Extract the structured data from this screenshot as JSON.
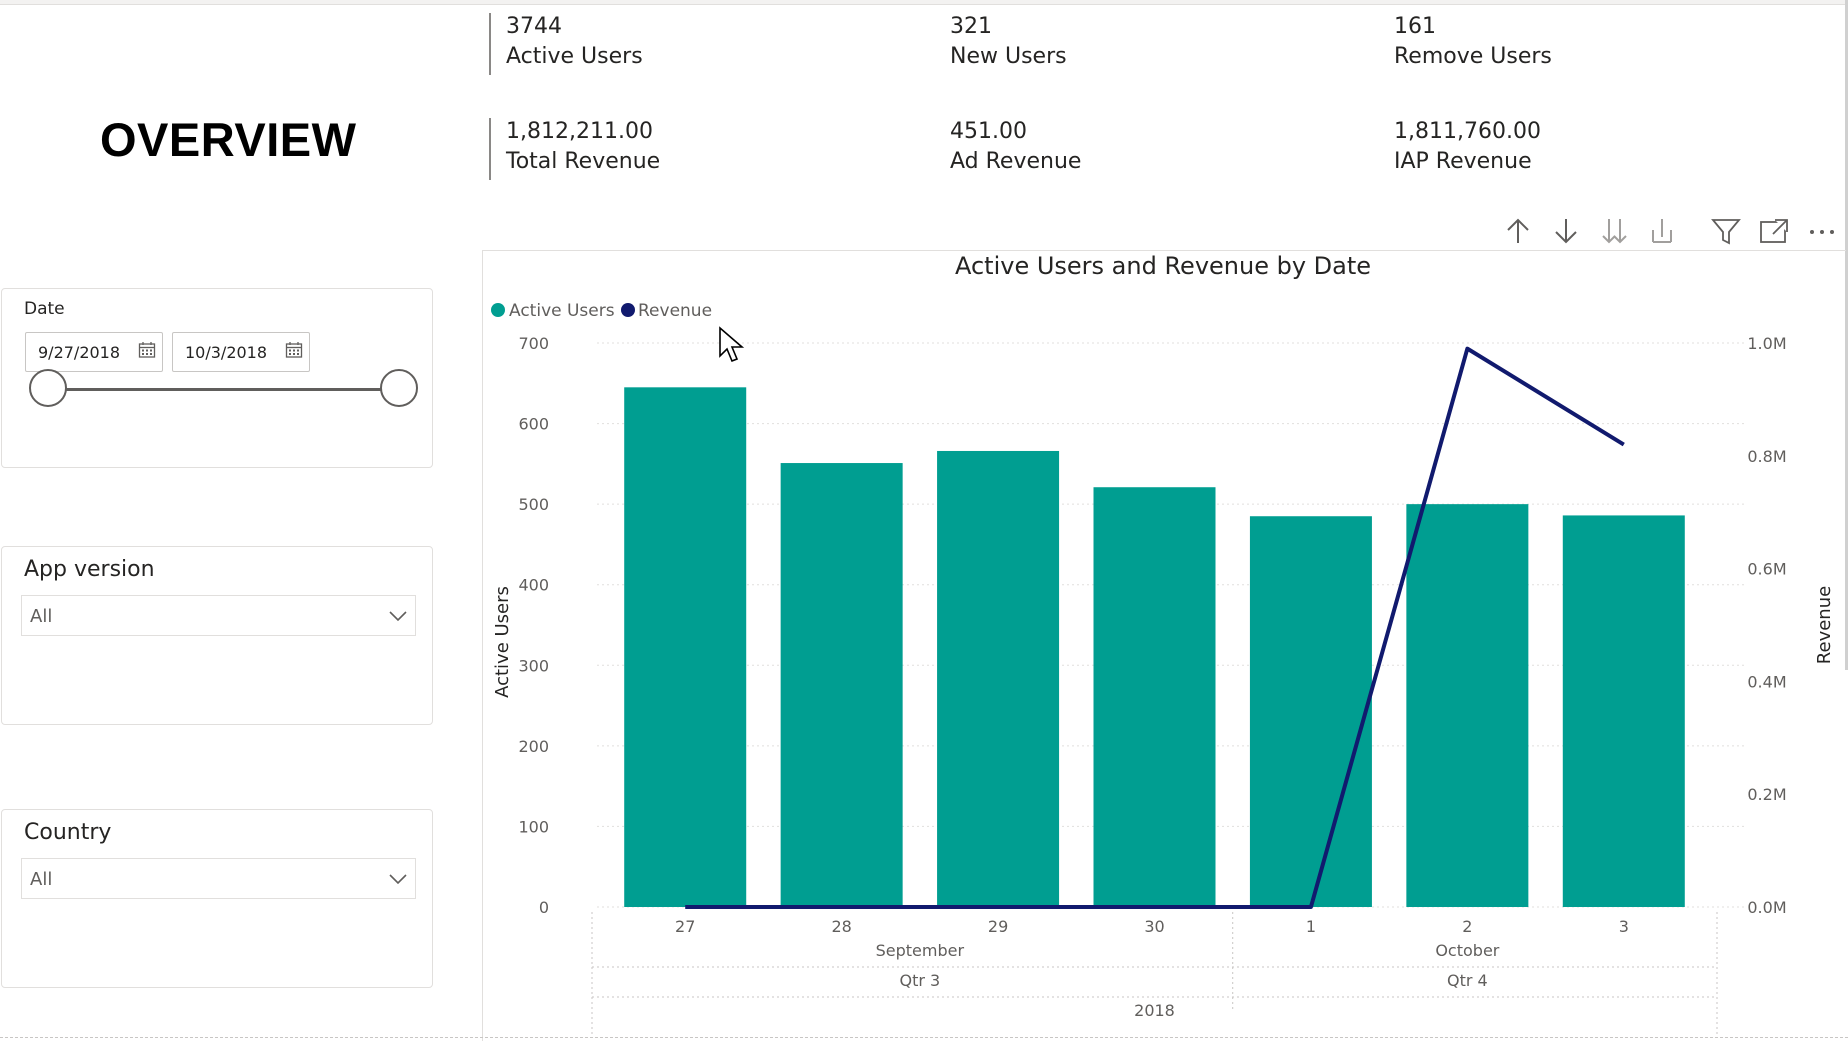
{
  "page": {
    "title": "OVERVIEW"
  },
  "kpis": {
    "row1": [
      {
        "value": "3744",
        "label": "Active Users"
      },
      {
        "value": "321",
        "label": "New Users"
      },
      {
        "value": "161",
        "label": "Remove Users"
      }
    ],
    "row2": [
      {
        "value": "1,812,211.00",
        "label": "Total Revenue"
      },
      {
        "value": "451.00",
        "label": "Ad Revenue"
      },
      {
        "value": "1,811,760.00",
        "label": "IAP Revenue"
      }
    ]
  },
  "slicers": {
    "date": {
      "title": "Date",
      "start": "9/27/2018",
      "end": "10/3/2018",
      "range_selected": [
        0.0,
        1.0
      ]
    },
    "app_version": {
      "title": "App version",
      "value": "All"
    },
    "country": {
      "title": "Country",
      "value": "All"
    }
  },
  "toolbar": {
    "icons": [
      "arrow-up-icon",
      "arrow-down-icon",
      "drill-down-all-icon",
      "expand-hierarchy-icon",
      "filter-icon",
      "focus-mode-icon",
      "more-options-icon"
    ]
  },
  "chart_data": {
    "type": "bar",
    "title": "Active Users and Revenue by Date",
    "legend": [
      {
        "name": "Active Users",
        "color": "#009e91"
      },
      {
        "name": "Revenue",
        "color": "#111a6e"
      }
    ],
    "legend_position": "top-left",
    "categories": [
      "27",
      "28",
      "29",
      "30",
      "1",
      "2",
      "3"
    ],
    "month_labels": [
      {
        "label": "September",
        "span": [
          0,
          3
        ]
      },
      {
        "label": "October",
        "span": [
          4,
          6
        ]
      }
    ],
    "quarter_labels": [
      {
        "label": "Qtr 3",
        "span": [
          0,
          3
        ]
      },
      {
        "label": "Qtr 4",
        "span": [
          4,
          6
        ]
      }
    ],
    "year_label": "2018",
    "series": [
      {
        "name": "Active Users",
        "type": "bar",
        "axis": "left",
        "values": [
          645,
          551,
          566,
          521,
          485,
          500,
          486
        ]
      },
      {
        "name": "Revenue",
        "type": "line",
        "axis": "right",
        "values": [
          0,
          0,
          0,
          0,
          0,
          990000,
          820000
        ]
      }
    ],
    "ylabel": "Active Users",
    "ylim": [
      0,
      700
    ],
    "yticks": [
      "0",
      "100",
      "200",
      "300",
      "400",
      "500",
      "600",
      "700"
    ],
    "y2label": "Revenue",
    "y2lim": [
      0,
      1000000
    ],
    "y2ticks": [
      "0.0M",
      "0.2M",
      "0.4M",
      "0.6M",
      "0.8M",
      "1.0M"
    ],
    "grid": true
  }
}
